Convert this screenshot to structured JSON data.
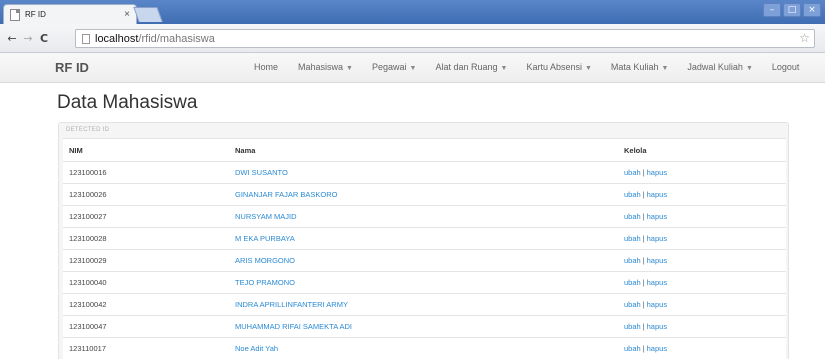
{
  "browser": {
    "tab_title": "RF ID",
    "tab_close": "×",
    "controls": {
      "minimize": "–",
      "maximize": "□",
      "close": "×"
    },
    "url_host": "localhost",
    "url_path": "/rfid/mahasiswa",
    "back": "←",
    "forward": "→",
    "reload": "C",
    "star": "☆"
  },
  "navbar": {
    "brand": "RF ID",
    "items": [
      {
        "label": "Home",
        "dropdown": false
      },
      {
        "label": "Mahasiswa",
        "dropdown": true
      },
      {
        "label": "Pegawai",
        "dropdown": true
      },
      {
        "label": "Alat dan Ruang",
        "dropdown": true
      },
      {
        "label": "Kartu Absensi",
        "dropdown": true
      },
      {
        "label": "Mata Kuliah",
        "dropdown": true
      },
      {
        "label": "Jadwal Kuliah",
        "dropdown": true
      },
      {
        "label": "Logout",
        "dropdown": false
      }
    ],
    "caret": "▼"
  },
  "page": {
    "title": "Data Mahasiswa",
    "detected_label": "DETECTED ID"
  },
  "table": {
    "headers": {
      "nim": "NIM",
      "nama": "Nama",
      "kelola": "Kelola"
    },
    "edit_label": "ubah",
    "separator": "|",
    "delete_label": "hapus",
    "rows": [
      {
        "nim": "123100016",
        "nama": "DWI SUSANTO"
      },
      {
        "nim": "123100026",
        "nama": "GINANJAR FAJAR BASKORO"
      },
      {
        "nim": "123100027",
        "nama": "NURSYAM MAJID"
      },
      {
        "nim": "123100028",
        "nama": "M EKA PURBAYA"
      },
      {
        "nim": "123100029",
        "nama": "ARIS MORGONO"
      },
      {
        "nim": "123100040",
        "nama": "TEJO PRAMONO"
      },
      {
        "nim": "123100042",
        "nama": "INDRA APRILLINFANTERI ARMY"
      },
      {
        "nim": "123100047",
        "nama": "MUHAMMAD RIFAI SAMEKTA ADI"
      },
      {
        "nim": "123110017",
        "nama": "Noe Adit Yah"
      }
    ]
  },
  "colors": {
    "link": "#2a8ad4",
    "titlebar": "#4a78bd",
    "panel_bg": "#f5f5f5"
  }
}
